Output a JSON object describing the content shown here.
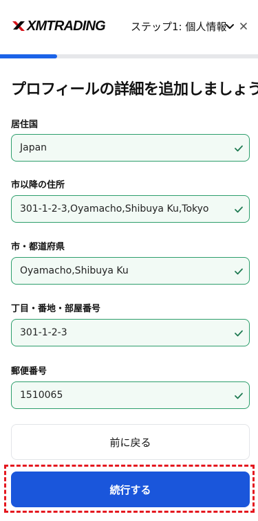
{
  "header": {
    "logo_text": "XMTRADING",
    "step_label": "ステップ1: 個人情報",
    "icons": [
      "chevron-down-icon",
      "close-icon"
    ]
  },
  "progress": {
    "fraction": 0.22,
    "color": "#1b63e8"
  },
  "title": "プロフィールの詳細を追加しましょう",
  "fields": [
    {
      "label": "居住国",
      "value": "Japan"
    },
    {
      "label": "市以降の住所",
      "value": "301-1-2-3,Oyamacho,Shibuya Ku,Tokyo"
    },
    {
      "label": "市・都道府県",
      "value": "Oyamacho,Shibuya Ku"
    },
    {
      "label": "丁目・番地・部屋番号",
      "value": "301-1-2-3"
    },
    {
      "label": "郵便番号",
      "value": "1510065"
    }
  ],
  "buttons": {
    "back_label": "前に戻る",
    "continue_label": "続行する"
  },
  "colors": {
    "primary": "#1a56db",
    "valid_border": "#2b9d6a",
    "valid_bg": "#f2faf5",
    "highlight": "#e4171f"
  }
}
